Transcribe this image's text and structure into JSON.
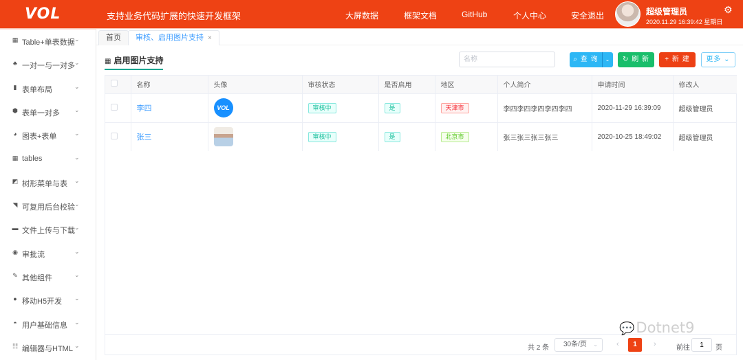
{
  "header": {
    "logo": "VOL",
    "slogan": "支持业务代码扩展的快速开发框架",
    "nav": [
      "大屏数据",
      "框架文档",
      "GitHub",
      "个人中心",
      "安全退出"
    ],
    "user_name": "超级管理员",
    "datetime": "2020.11.29 16:39:42 星期日",
    "settings_icon": "⚙",
    "brand_color": "#ee4214"
  },
  "sidebar": {
    "items": [
      {
        "icon": "grid-icon",
        "glyph": "▦",
        "label": "Table+单表数据"
      },
      {
        "icon": "cubes-icon",
        "glyph": "♣",
        "label": "一对一与一对多"
      },
      {
        "icon": "bar-chart-icon",
        "glyph": "▮",
        "label": "表单布局"
      },
      {
        "icon": "cube-icon",
        "glyph": "⬢",
        "label": "表单一对多"
      },
      {
        "icon": "pie-chart-icon",
        "glyph": "◕",
        "label": "图表+表单"
      },
      {
        "icon": "grid-icon",
        "glyph": "▦",
        "label": "tables"
      },
      {
        "icon": "area-chart-icon",
        "glyph": "◩",
        "label": "树形菜单与表"
      },
      {
        "icon": "rss-icon",
        "glyph": "◥",
        "label": "可复用后台校验"
      },
      {
        "icon": "folder-icon",
        "glyph": "▬",
        "label": "文件上传与下载"
      },
      {
        "icon": "dribbble-icon",
        "glyph": "◉",
        "label": "审批流"
      },
      {
        "icon": "wrench-icon",
        "glyph": "✎",
        "label": "其他组件"
      },
      {
        "icon": "apple-icon",
        "glyph": "●",
        "label": "移动H5开发"
      },
      {
        "icon": "user-group-icon",
        "glyph": "◓",
        "label": "用户基础信息"
      },
      {
        "icon": "sliders-icon",
        "glyph": "☷",
        "label": "编辑器与HTML"
      }
    ],
    "chevron": "⌄"
  },
  "tabs": [
    {
      "label": "首页",
      "active": false
    },
    {
      "label": "审核、启用图片支持",
      "active": true,
      "close": "×"
    }
  ],
  "panel": {
    "title": "启用图片支持",
    "title_icon": "▦",
    "search_placeholder": "名称",
    "buttons": {
      "query": "⌕ 查 询",
      "query_drop": "⌄",
      "refresh": "↻ 刷 新",
      "new": "+ 新 建",
      "more": "更多 ⌄"
    }
  },
  "table": {
    "columns": [
      "名称",
      "头像",
      "审核状态",
      "是否启用",
      "地区",
      "个人简介",
      "申请时间",
      "修改人"
    ],
    "rows": [
      {
        "name": "李四",
        "avatar": "VOL",
        "status": "审核中",
        "enabled": "是",
        "region": "天津市",
        "region_color": "red",
        "bio": "李四李四李四李四李四",
        "apply_time": "2020-11-29 16:39:09",
        "modifier": "超级管理员"
      },
      {
        "name": "张三",
        "avatar": "photo",
        "status": "审核中",
        "enabled": "是",
        "region": "北京市",
        "region_color": "green",
        "bio": "张三张三张三张三",
        "apply_time": "2020-10-25 18:49:02",
        "modifier": "超级管理员"
      }
    ]
  },
  "pager": {
    "total": "共 2 条",
    "page_size": "30条/页",
    "page_size_drop": "⌄",
    "prev": "‹",
    "current": "1",
    "next": "›",
    "goto_label": "前往",
    "goto_value": "1",
    "page_label": "页"
  },
  "watermark": {
    "icon": "wechat-icon",
    "glyph": "💬",
    "text": "Dotnet9"
  }
}
